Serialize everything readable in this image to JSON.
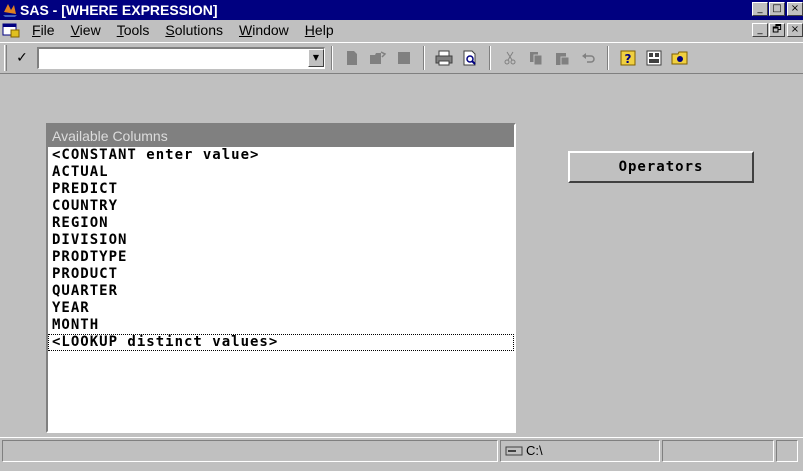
{
  "window": {
    "title": "SAS - [WHERE EXPRESSION]",
    "title_buttons": [
      "_",
      "□",
      "×"
    ],
    "mdi_buttons": [
      "_",
      "🗗",
      "×"
    ]
  },
  "menu": {
    "items": [
      {
        "accel": "F",
        "rest": "ile"
      },
      {
        "accel": "V",
        "rest": "iew"
      },
      {
        "accel": "T",
        "rest": "ools"
      },
      {
        "accel": "S",
        "rest": "olutions"
      },
      {
        "accel": "W",
        "rest": "indow"
      },
      {
        "accel": "H",
        "rest": "elp"
      }
    ]
  },
  "toolbar": {
    "command_value": "",
    "check_glyph": "✓",
    "drop_glyph": "▼",
    "icons": [
      "new-icon",
      "open-icon",
      "save-icon",
      "print-icon",
      "print-preview-icon",
      "cut-icon",
      "copy-icon",
      "paste-icon",
      "undo-icon",
      "help-icon",
      "explorer-icon",
      "folder-icon"
    ]
  },
  "columns": {
    "header": "Available Columns",
    "items": [
      "<CONSTANT enter value>",
      "ACTUAL",
      "PREDICT",
      "COUNTRY",
      "REGION",
      "DIVISION",
      "PRODTYPE",
      "PRODUCT",
      "QUARTER",
      "YEAR",
      "MONTH",
      "<LOOKUP distinct values>"
    ]
  },
  "operators_button": "Operators",
  "statusbar": {
    "path": "C:\\"
  }
}
